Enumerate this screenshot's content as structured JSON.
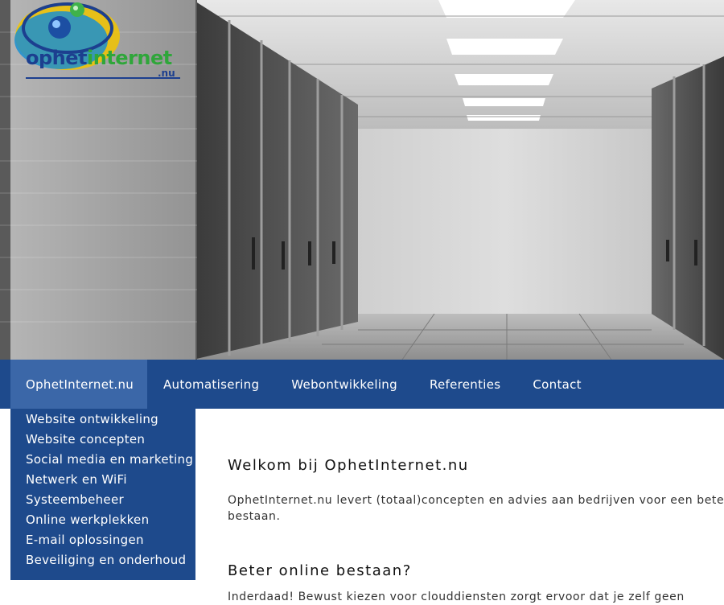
{
  "brand": {
    "logo_main": "ophet",
    "logo_accent": "internet",
    "logo_sub": ".nu"
  },
  "nav": {
    "items": [
      {
        "label": "OphetInternet.nu",
        "active": true
      },
      {
        "label": "Automatisering"
      },
      {
        "label": "Webontwikkeling"
      },
      {
        "label": "Referenties"
      },
      {
        "label": "Contact"
      }
    ]
  },
  "dropdown": {
    "items": [
      "Website ontwikkeling",
      "Website concepten",
      "Social media en marketing",
      "Netwerk en WiFi",
      "Systeembeheer",
      "Online werkplekken",
      "E-mail oplossingen",
      "Beveiliging en onderhoud"
    ]
  },
  "content": {
    "welcome_title": "Welkom bij OphetInternet.nu",
    "welcome_line1": "OphetInternet.nu levert (totaal)concepten en advies aan bedrijven voor een beter",
    "welcome_line2": "bestaan.",
    "section_title": "Beter online bestaan?",
    "section_line1": "Inderdaad! Bewust kiezen voor clouddiensten zorgt ervoor dat je zelf geen"
  },
  "colors": {
    "nav_bg": "#1e4a8c",
    "nav_active": "#3b67a8",
    "logo_blue": "#1c3f8f",
    "logo_green": "#2fa63a"
  }
}
